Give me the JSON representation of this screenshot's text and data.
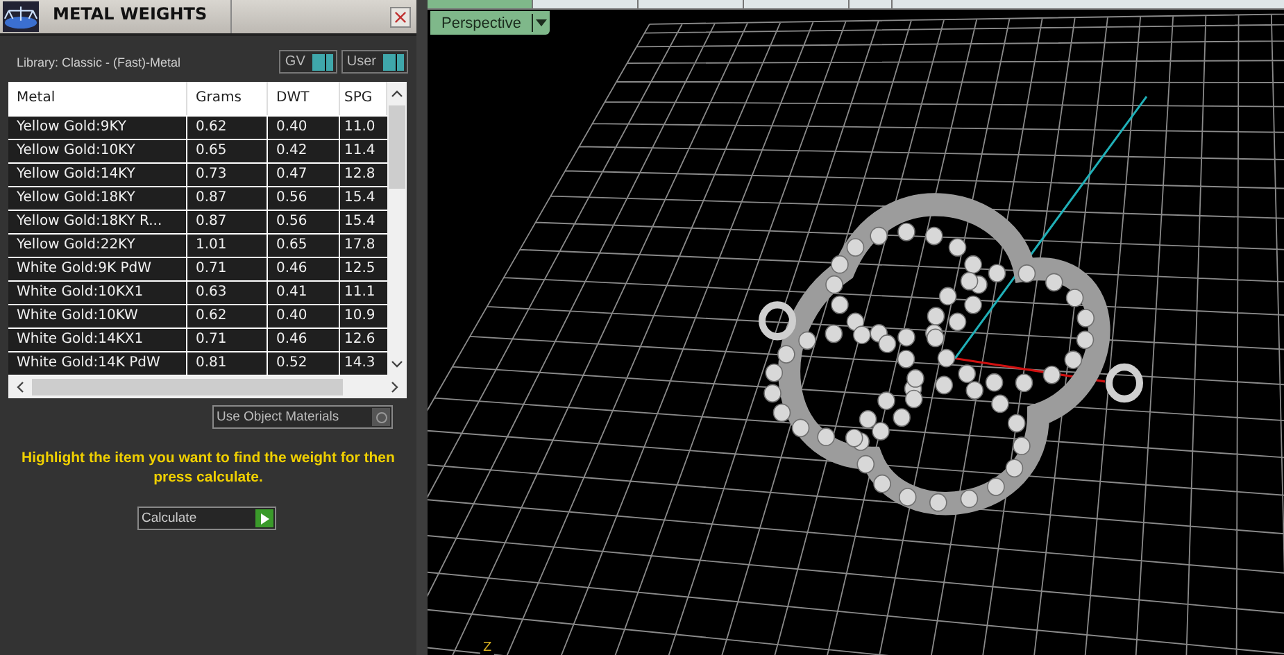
{
  "panel": {
    "title": "METAL WEIGHTS",
    "library": "Library: Classic - (Fast)-Metal",
    "toggles": [
      {
        "label": "GV",
        "on": true
      },
      {
        "label": "User",
        "on": true
      }
    ],
    "table": {
      "columns": [
        "Metal",
        "Grams",
        "DWT",
        "SPG"
      ],
      "rows": [
        {
          "cells": [
            "Yellow Gold:9KY",
            "0.62",
            "0.40",
            "11.0"
          ]
        },
        {
          "cells": [
            "Yellow Gold:10KY",
            "0.65",
            "0.42",
            "11.4"
          ]
        },
        {
          "cells": [
            "Yellow Gold:14KY",
            "0.73",
            "0.47",
            "12.8"
          ]
        },
        {
          "cells": [
            "Yellow Gold:18KY",
            "0.87",
            "0.56",
            "15.4"
          ]
        },
        {
          "cells": [
            "Yellow Gold:18KY R...",
            "0.87",
            "0.56",
            "15.4"
          ]
        },
        {
          "cells": [
            "Yellow Gold:22KY",
            "1.01",
            "0.65",
            "17.8"
          ]
        },
        {
          "cells": [
            "White Gold:9K PdW",
            "0.71",
            "0.46",
            "12.5"
          ]
        },
        {
          "cells": [
            "White Gold:10KX1",
            "0.63",
            "0.41",
            "11.1"
          ]
        },
        {
          "cells": [
            "White Gold:10KW",
            "0.62",
            "0.40",
            "10.9"
          ]
        },
        {
          "cells": [
            "White Gold:14KX1",
            "0.71",
            "0.46",
            "12.6"
          ]
        },
        {
          "cells": [
            "White Gold:14K PdW",
            "0.81",
            "0.52",
            "14.3"
          ]
        }
      ]
    },
    "use_object_materials": {
      "label": "Use Object Materials",
      "on": false
    },
    "hint": "Highlight the item you want to find the weight for then press calculate.",
    "calculate": "Calculate"
  },
  "viewport": {
    "view_menu": "Perspective",
    "axis_label": "Z"
  }
}
